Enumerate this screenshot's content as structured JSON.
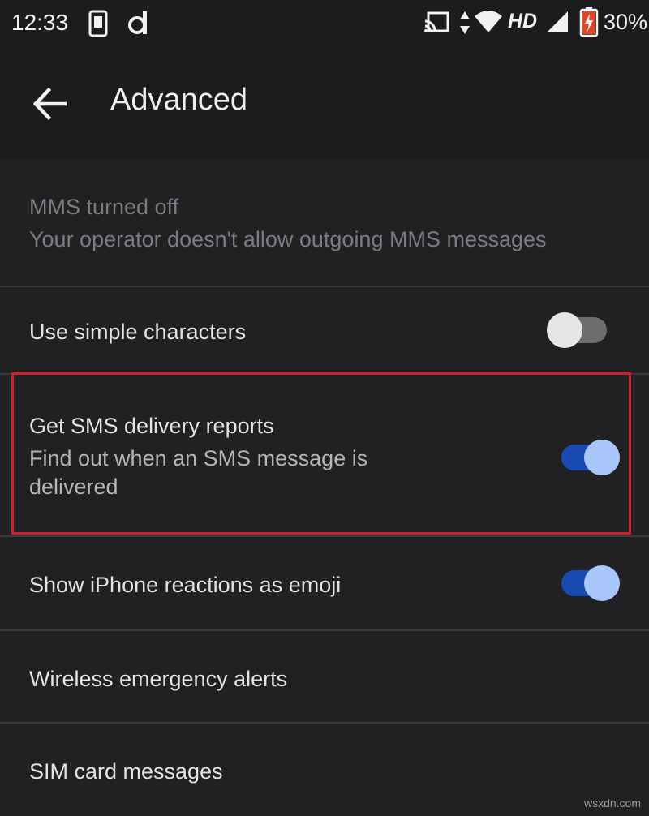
{
  "status_bar": {
    "time": "12:33",
    "network_type": "HD",
    "battery_percent": "30%",
    "icons": [
      "phone-icon",
      "d-app-icon",
      "cast-icon",
      "data-arrows-icon",
      "wifi-icon",
      "cell-signal-icon",
      "battery-charging-icon"
    ]
  },
  "app_bar": {
    "title": "Advanced",
    "back_icon": "arrow-left-icon"
  },
  "settings": {
    "mms": {
      "title": "MMS turned off",
      "subtitle": "Your operator doesn't allow outgoing MMS messages",
      "enabled": false
    },
    "simple_characters": {
      "title": "Use simple characters",
      "toggle_on": false
    },
    "sms_delivery_reports": {
      "title": "Get SMS delivery reports",
      "subtitle_line1": "Find out when an SMS message is",
      "subtitle_line2": "delivered",
      "toggle_on": true,
      "highlighted": true
    },
    "iphone_reactions": {
      "title": "Show iPhone reactions as emoji",
      "toggle_on": true
    },
    "wireless_alerts": {
      "title": "Wireless emergency alerts"
    },
    "sim_messages": {
      "title": "SIM card messages"
    }
  },
  "colors": {
    "background": "#212124",
    "toggle_on_track": "#1a4bb3",
    "toggle_on_thumb": "#a9c6fa",
    "toggle_off_track": "#6d6d70",
    "toggle_off_thumb": "#e6e6e6",
    "highlight": "#d0202a"
  },
  "watermark": "wsxdn.com"
}
